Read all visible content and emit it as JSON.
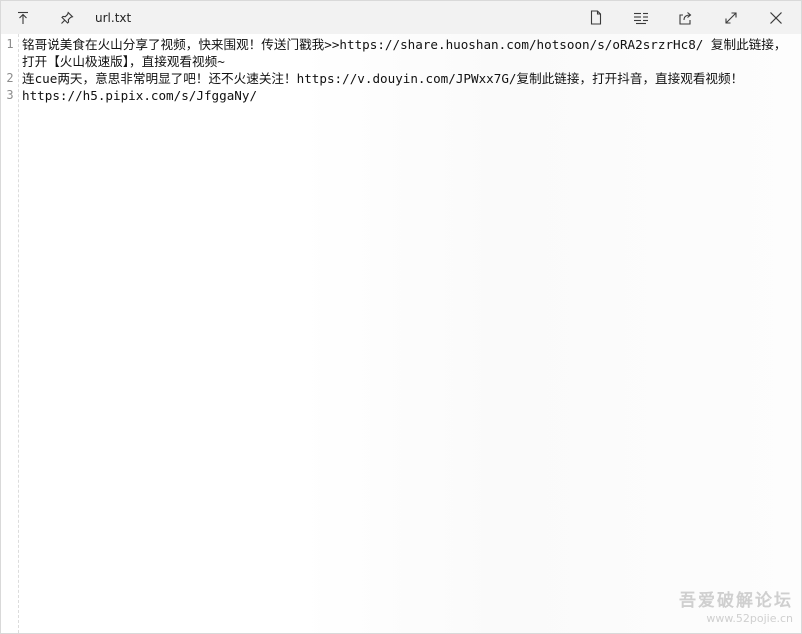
{
  "window": {
    "title": "url.txt"
  },
  "titlebar": {
    "left_icons": [
      "arrow-up-to-top-icon",
      "pin-icon"
    ],
    "right_icons": [
      "new-document-icon",
      "list-icon",
      "share-icon",
      "maximize-icon",
      "close-icon"
    ]
  },
  "editor": {
    "lines": [
      {
        "number": "1",
        "text": "铭哥说美食在火山分享了视频，快来围观！传送门戳我>>https://share.huoshan.com/hotsoon/s/oRA2srzrHc8/ 复制此链接，打开【火山极速版】，直接观看视频~"
      },
      {
        "number": "2",
        "text": "连cue两天，意思非常明显了吧！还不火速关注！https://v.douyin.com/JPWxx7G/复制此链接，打开抖音，直接观看视频！"
      },
      {
        "number": "3",
        "text": "https://h5.pipix.com/s/JfggaNy/"
      }
    ]
  },
  "watermark": {
    "main": "吾爱破解论坛",
    "sub": "www.52pojie.cn"
  }
}
